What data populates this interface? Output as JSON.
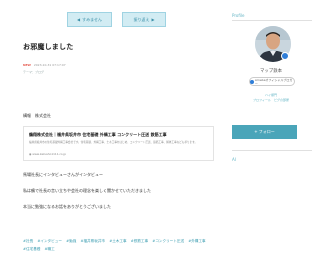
{
  "nav": {
    "prev_label": "すみません",
    "next_label": "振り返え"
  },
  "article": {
    "title": "お邪魔しました",
    "new_badge": "NEW",
    "timestamp": "2023-10-31 07:17:07",
    "theme": "テーマ：ブログ",
    "representative": "構報　株式会社",
    "card": {
      "title": "鶴翔株式会社｜福井県坂井市 住宅基礎 外構工事 コンクリート圧送 鉄筋工事",
      "description": "福井県坂井市の住宅基礎外構工事会社です。住宅基礎、外構工事、土木工事をはじめ、コンクリート圧送、鉄筋工事、解体工事なども承ります。",
      "url": "www.kakusho1111.co.jp"
    },
    "paragraphs": [
      "馬場社長にインタビューさんがインタビュー",
      "私は鶴で社長の言い立ちや会社の理念を楽しく聞かせていただきました",
      "本当に勉強になるお話をありがとうございました"
    ],
    "tags": [
      "#社長",
      "#インタビュー",
      "#勉強",
      "#福井県坂井市",
      "#土木工事",
      "#鉄筋工事",
      "#コンクリート圧送",
      "#外構工事",
      "#住宅基礎",
      "#職工"
    ]
  },
  "sidebar": {
    "profile_label": "Profile",
    "name": "マップ鉄本",
    "official_badge": "Amebaオフィシャルブロガー",
    "stats_line1": "ハイ順門",
    "stats_line2": "プロフィール　ピグの部屋",
    "follow_label": "+ フォロー",
    "ai_label": "AI"
  }
}
